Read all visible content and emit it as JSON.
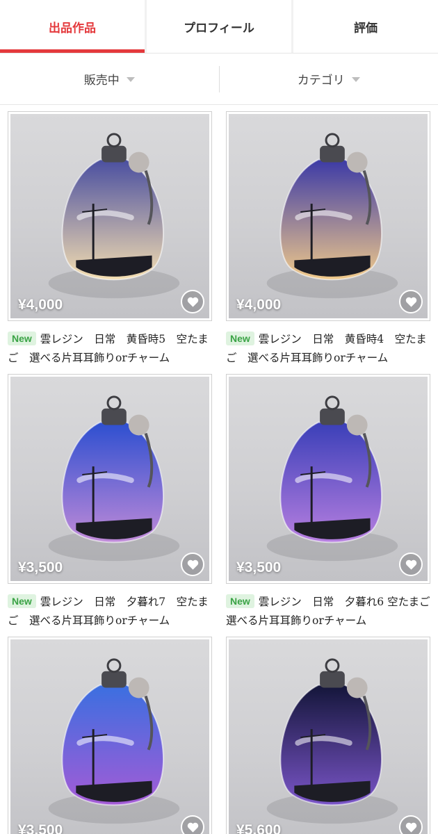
{
  "tabs": [
    {
      "label": "出品作品",
      "active": true
    },
    {
      "label": "プロフィール",
      "active": false
    },
    {
      "label": "評価",
      "active": false
    }
  ],
  "filters": [
    {
      "label": "販売中"
    },
    {
      "label": "カテゴリ"
    }
  ],
  "accent_color": "#e4393c",
  "new_badge_color": "#3aa345",
  "items": [
    {
      "price": "¥4,000",
      "badge": "New",
      "title": "雲レジン　日常　黄昏時5　空たまご　選べる片耳耳飾りorチャーム",
      "liquid_top": "#4a4fa0",
      "liquid_bottom": "#f3ddb0"
    },
    {
      "price": "¥4,000",
      "badge": "New",
      "title": "雲レジン　日常　黄昏時4　空たまご　選べる片耳耳飾りorチャーム",
      "liquid_top": "#3c3aa6",
      "liquid_bottom": "#f0c98a"
    },
    {
      "price": "¥3,500",
      "badge": "New",
      "title": "雲レジン　日常　夕暮れ7　空たまご　選べる片耳耳飾りorチャーム",
      "liquid_top": "#2d4fd0",
      "liquid_bottom": "#c08ad8"
    },
    {
      "price": "¥3,500",
      "badge": "New",
      "title": "雲レジン　日常　夕暮れ6 空たまご　選べる片耳耳飾りorチャーム",
      "liquid_top": "#3a3fb8",
      "liquid_bottom": "#b77fe0"
    },
    {
      "price": "¥3,500",
      "badge": "",
      "title": "",
      "liquid_top": "#3b6fe0",
      "liquid_bottom": "#a45bd6"
    },
    {
      "price": "¥5,600",
      "badge": "",
      "title": "",
      "liquid_top": "#14163a",
      "liquid_bottom": "#7a55c8"
    }
  ]
}
